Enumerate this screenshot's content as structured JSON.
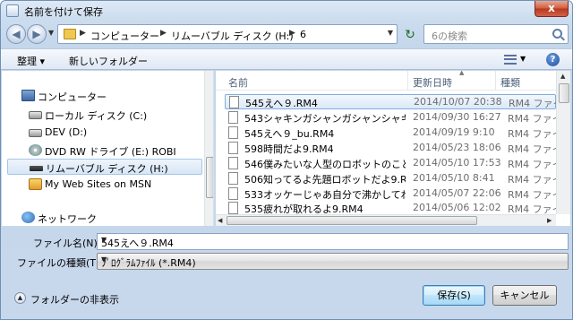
{
  "window": {
    "title": "名前を付けて保存",
    "close_label": "x"
  },
  "address": {
    "crumbs": [
      "コンピューター",
      "リムーバブル ディスク (H:)",
      "6"
    ],
    "search_placeholder": "6の検索"
  },
  "toolbar": {
    "organize": "整理 ▾",
    "new_folder": "新しいフォルダー"
  },
  "nav": {
    "items": [
      {
        "label": "コンピューター"
      },
      {
        "label": "ローカル ディスク (C:)"
      },
      {
        "label": "DEV (D:)"
      },
      {
        "label": "DVD RW ドライブ (E:) ROBI"
      },
      {
        "label": "リムーバブル ディスク (H:)",
        "selected": true
      },
      {
        "label": "My Web Sites on MSN"
      },
      {
        "label": "ネットワーク"
      }
    ]
  },
  "files": {
    "columns": {
      "name": "名前",
      "date": "更新日時",
      "type": "種類"
    },
    "rows": [
      {
        "name": "545えへ９.RM4",
        "date": "2014/10/07 20:38",
        "type": "RM4 ファイル",
        "selected": true
      },
      {
        "name": "543シャキンガシャンガシャンシャキン...",
        "date": "2014/09/30 16:27",
        "type": "RM4 ファイル"
      },
      {
        "name": "545えへ９_bu.RM4",
        "date": "2014/09/19 9:10",
        "type": "RM4 ファイル"
      },
      {
        "name": "598時間だよ9.RM4",
        "date": "2014/05/23 18:06",
        "type": "RM4 ファイル"
      },
      {
        "name": "546僕みたいな人型のロボットのことを...",
        "date": "2014/05/10 17:53",
        "type": "RM4 ファイル"
      },
      {
        "name": "506知ってるよ先題ロボットだよ9.RM4",
        "date": "2014/05/10 8:41",
        "type": "RM4 ファイル"
      },
      {
        "name": "533オッケーじゃあ自分で沸かしてね9....",
        "date": "2014/05/07 22:06",
        "type": "RM4 ファイル"
      },
      {
        "name": "535疲れが取れるよ9.RM4",
        "date": "2014/05/06 12:02",
        "type": "RM4 ファイル"
      }
    ]
  },
  "form": {
    "filename_label": "ファイル名(N):",
    "filename_value": "545えへ９.RM4",
    "filetype_label": "ファイルの種類(T):",
    "filetype_value": "ﾌﾟﾛｸﾞﾗﾑﾌｧｲﾙ (*.RM4)"
  },
  "footer": {
    "hide_folders": "フォルダーの非表示",
    "save": "保存(S)",
    "cancel": "キャンセル"
  }
}
